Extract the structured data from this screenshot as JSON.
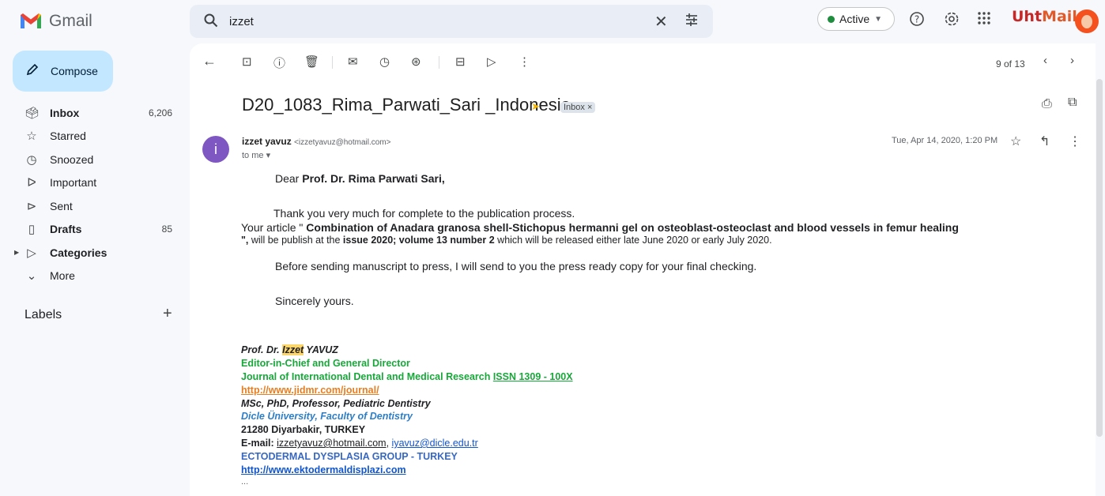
{
  "app": {
    "name": "Gmail",
    "logo_icon": "gmail-m-icon"
  },
  "search": {
    "value": "izzet",
    "clear_icon": "close-icon",
    "options_icon": "tune-icon"
  },
  "status": {
    "label": "Active",
    "color": "#1e8e3e"
  },
  "brand": {
    "part1": "Uht",
    "part2": "Mail"
  },
  "compose": {
    "label": "Compose"
  },
  "nav": [
    {
      "label": "Inbox",
      "count": "6,206",
      "icon": "inbox-icon"
    },
    {
      "label": "Starred",
      "count": "",
      "icon": "star-icon"
    },
    {
      "label": "Snoozed",
      "count": "",
      "icon": "clock-icon"
    },
    {
      "label": "Important",
      "count": "",
      "icon": "important-icon"
    },
    {
      "label": "Sent",
      "count": "",
      "icon": "send-icon"
    },
    {
      "label": "Drafts",
      "count": "85",
      "icon": "draft-icon"
    },
    {
      "label": "Categories",
      "count": "",
      "icon": "label-icon"
    },
    {
      "label": "More",
      "count": "",
      "icon": "chevron-down-icon"
    }
  ],
  "labels": {
    "title": "Labels"
  },
  "pager": {
    "text": "9 of 13"
  },
  "email": {
    "subject": "D20_1083_Rima_Parwati_Sari _Indonesia",
    "label_chip": "Inbox ×",
    "sender_name": "izzet yavuz",
    "sender_email": "<izzetyavuz@hotmail.com>",
    "avatar_letter": "i",
    "to": "to me",
    "date": "Tue, Apr 14, 2020, 1:20 PM",
    "greeting_prefix": "Dear ",
    "greeting_name": "Prof. Dr. Rima Parwati Sari,",
    "thanks": "Thank you very much for complete to the publication process.",
    "article_prefix": "Your article \" ",
    "article_title": "Combination of Anadara granosa shell-Stichopus hermanni gel on osteoblast-osteoclast and blood vessels in femur healing",
    "article_close": "\",",
    "publish_prefix": " will be publish at the ",
    "issue": "issue 2020; volume 13 number 2",
    "publish_suffix": " which will be released either late June 2020 or early July 2020.",
    "before": "Before sending manuscript to press, I will send to you the press ready copy for your final checking.",
    "closing": "Sincerely yours.",
    "sig_prefix": "Prof. Dr. ",
    "sig_highlight": "Izzet",
    "sig_suffix": " YAVUZ",
    "sig_role": "Editor-in-Chief and General Director",
    "sig_journal": "Journal of International Dental and Medical Research ",
    "sig_issn": "ISSN 1309 - 100X",
    "sig_url": "http://www.jidmr.com/journal/",
    "sig_degrees": "MSc, PhD, Professor, Pediatric Dentistry",
    "sig_univ": "Dicle Üniversity, Faculty of Dentistry",
    "sig_city": "21280 Diyarbakir, TURKEY",
    "sig_email_label": "E-mail: ",
    "sig_email1": "izzetyavuz@hotmail.com",
    "sig_email_sep": ", ",
    "sig_email2": "iyavuz@dicle.edu.tr",
    "sig_group": "ECTODERMAL DYSPLASIA GROUP - TURKEY",
    "sig_group_url": "http://www.ektodermaldisplazi.com",
    "ellipsis": "..."
  }
}
